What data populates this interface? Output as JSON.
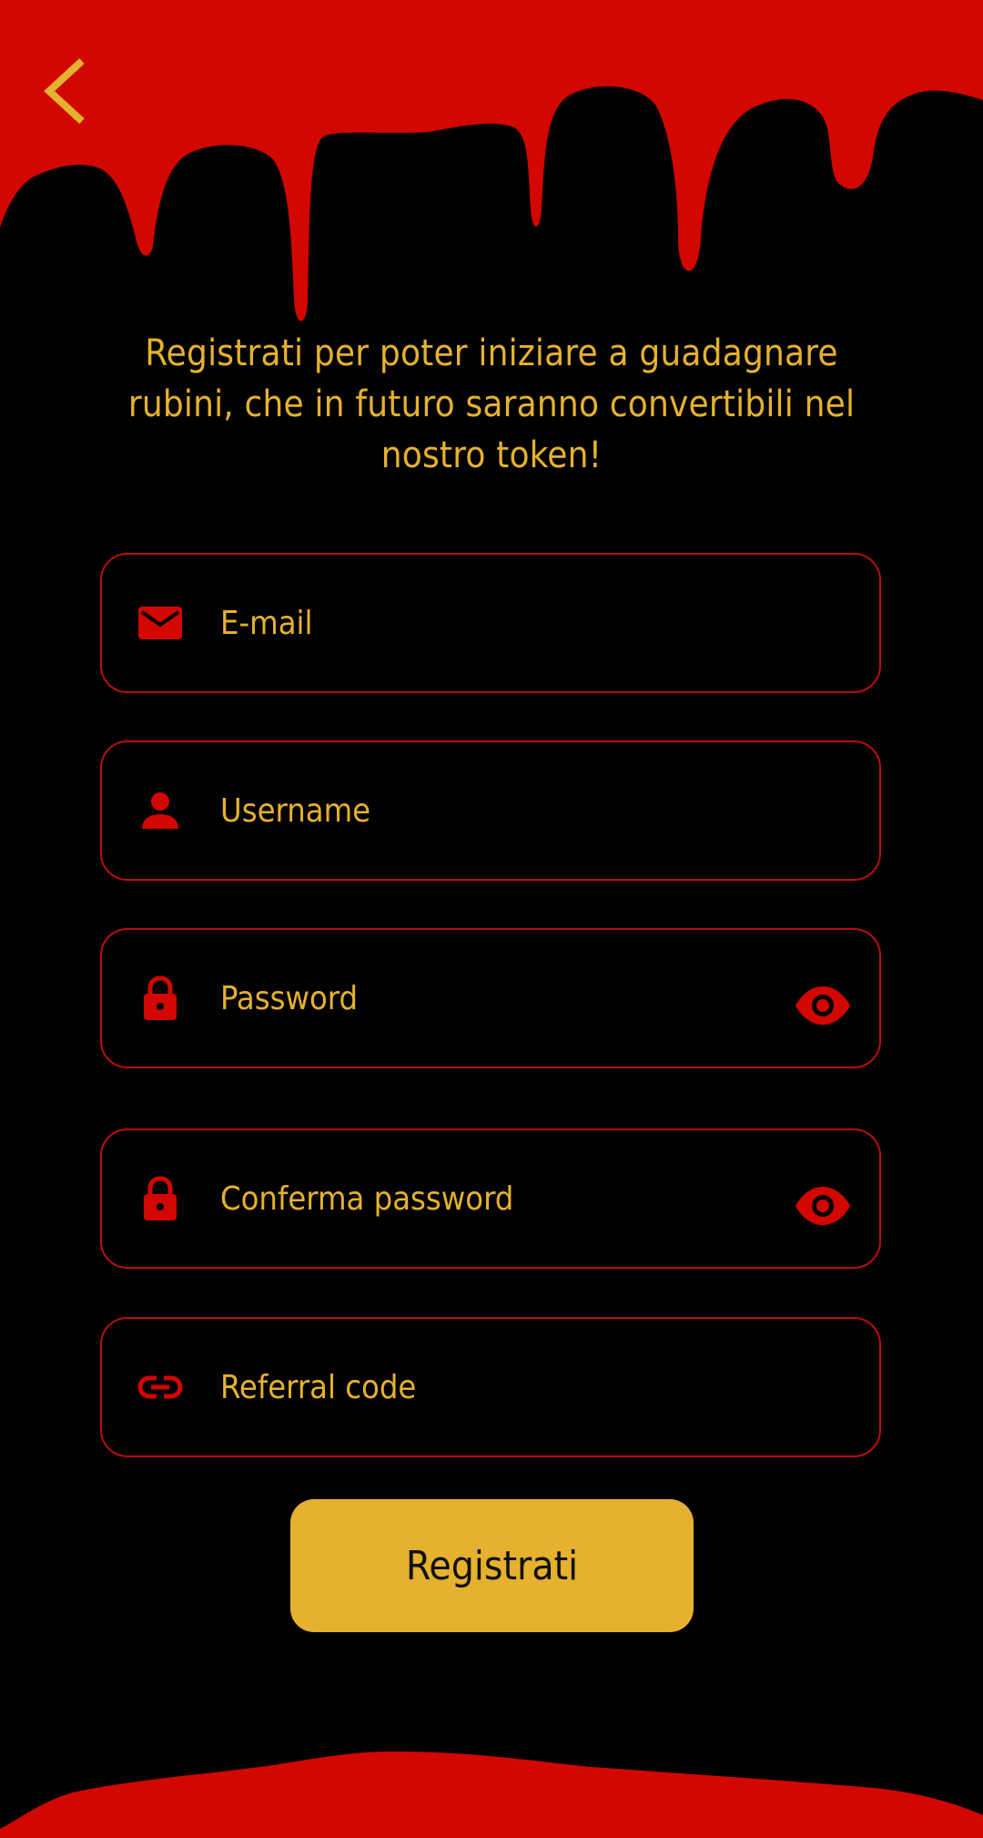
{
  "colors": {
    "background": "#000000",
    "accent_red": "#D10700",
    "accent_gold": "#E5B12E",
    "field_border": "#B70F0F"
  },
  "header": {
    "back_icon": "chevron-left-icon"
  },
  "intro": {
    "text": "Registrati per poter iniziare a guadagnare rubini, che in futuro saranno convertibili nel nostro token!"
  },
  "form": {
    "email": {
      "placeholder": "E-mail",
      "value": "",
      "icon": "envelope-icon"
    },
    "username": {
      "placeholder": "Username",
      "value": "",
      "icon": "person-icon"
    },
    "password": {
      "placeholder": "Password",
      "value": "",
      "icon": "lock-icon",
      "toggle_icon": "eye-icon"
    },
    "confirm_password": {
      "placeholder": "Conferma password",
      "value": "",
      "icon": "lock-icon",
      "toggle_icon": "eye-icon"
    },
    "referral": {
      "placeholder": "Referral code",
      "value": "",
      "icon": "link-icon"
    },
    "submit_label": "Registrati"
  }
}
